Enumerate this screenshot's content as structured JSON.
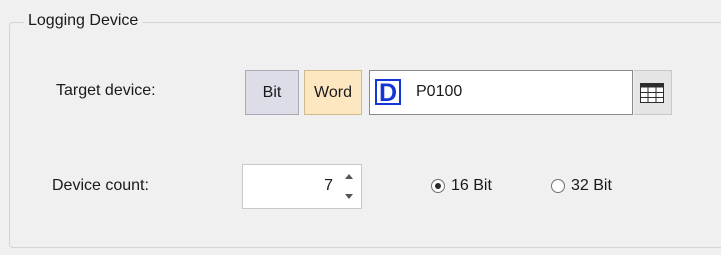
{
  "group": {
    "title": "Logging Device"
  },
  "target": {
    "label": "Target device:",
    "bit_label": "Bit",
    "word_label": "Word",
    "device_prefix": "D",
    "device_value": "P0100",
    "browse_icon": "table-grid-icon"
  },
  "count": {
    "label": "Device count:",
    "value": "7"
  },
  "size": {
    "option_16": "16 Bit",
    "option_32": "32 Bit",
    "selected": "16 Bit"
  },
  "colors": {
    "bit_button_bg": "#dcdde6",
    "word_button_bg": "#fde7c0",
    "device_prefix": "#1436d6"
  }
}
